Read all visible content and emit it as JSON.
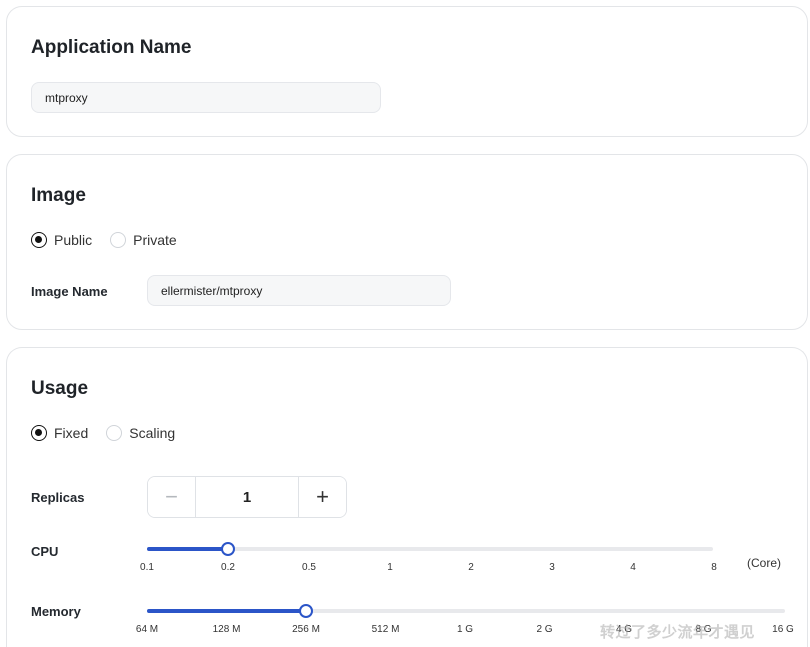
{
  "app_section": {
    "title": "Application Name",
    "name_value": "mtproxy"
  },
  "image_section": {
    "title": "Image",
    "radio_options": [
      {
        "label": "Public",
        "checked": true
      },
      {
        "label": "Private",
        "checked": false
      }
    ],
    "image_name_label": "Image Name",
    "image_name_value": "ellermister/mtproxy"
  },
  "usage_section": {
    "title": "Usage",
    "radio_options": [
      {
        "label": "Fixed",
        "checked": true
      },
      {
        "label": "Scaling",
        "checked": false
      }
    ],
    "replicas": {
      "label": "Replicas",
      "value": "1",
      "minus_symbol": "−",
      "plus_symbol": "+"
    },
    "cpu": {
      "label": "CPU",
      "unit": "(Core)",
      "ticks": [
        "0.1",
        "0.2",
        "0.5",
        "1",
        "2",
        "3",
        "4",
        "8"
      ],
      "selected_index": 1
    },
    "memory": {
      "label": "Memory",
      "ticks": [
        "64 M",
        "128 M",
        "256 M",
        "512 M",
        "1 G",
        "2 G",
        "4 G",
        "8 G",
        "16 G"
      ],
      "selected_index": 2
    }
  },
  "watermark": "转过了多少流年才遇见",
  "colors": {
    "accent": "#2b55c8",
    "track": "#e8e9ec",
    "input_bg": "#f6f7f8",
    "card_border": "#e3e5e8"
  }
}
